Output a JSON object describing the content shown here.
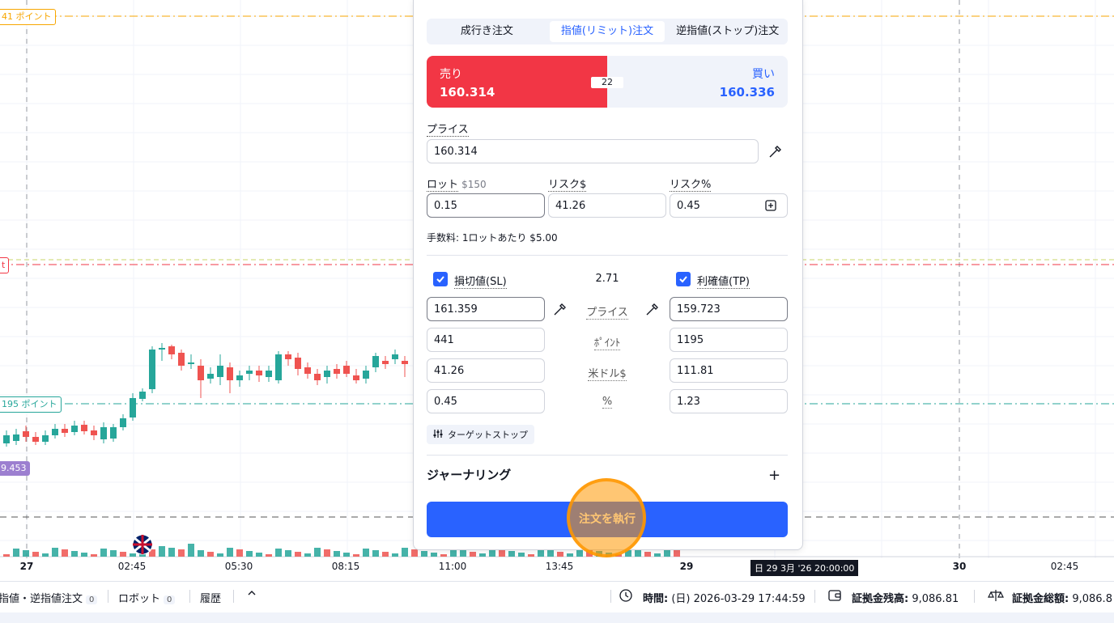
{
  "chart": {
    "labels": {
      "tp_points": "41 ポイント",
      "left_t": "t",
      "sl_points": "195 ポイント",
      "price_tag": "9.453"
    },
    "x_ticks": [
      {
        "label": "27",
        "bold": true
      },
      {
        "label": "02:45",
        "bold": false
      },
      {
        "label": "05:30",
        "bold": false
      },
      {
        "label": "08:15",
        "bold": false
      },
      {
        "label": "11:00",
        "bold": false
      },
      {
        "label": "13:45",
        "bold": false
      },
      {
        "label": "29",
        "bold": true
      },
      {
        "label": "30",
        "bold": true
      },
      {
        "label": "02:45",
        "bold": false
      }
    ],
    "cursor_time": "日 29 3月 '26 20:00:00",
    "colors": {
      "up": "#26a69a",
      "down": "#ef5350",
      "tp_line": "#f7a600",
      "sl_line": "#26a69a",
      "entry_line": "#f23645"
    }
  },
  "panel": {
    "tabs": [
      "成行き注文",
      "指値(リミット)注文",
      "逆指値(ストップ)注文"
    ],
    "active_tab": "指値(リミット)注文",
    "sell_label": "売り",
    "sell_price": "160.314",
    "buy_label": "買い",
    "buy_price": "160.336",
    "spread": "22",
    "price_label": "プライス",
    "price_value": "160.314",
    "lot_label": "ロット",
    "lot_sub": "$150",
    "lot_value": "0.15",
    "risk_usd_label": "リスク$",
    "risk_usd_value": "41.26",
    "risk_pct_label": "リスク%",
    "risk_pct_value": "0.45",
    "fee_text": "手数料: 1ロットあたり $5.00",
    "sl_label": "損切値(SL)",
    "rr_value": "2.71",
    "tp_label": "利確値(TP)",
    "mid_labels": [
      "プライス",
      "ﾎﾟｲﾝﾄ",
      "米ドル$",
      "%"
    ],
    "sl_values": [
      "161.359",
      "441",
      "41.26",
      "0.45"
    ],
    "tp_values": [
      "159.723",
      "1195",
      "111.81",
      "1.23"
    ],
    "trailing_label": "ターゲットストップ",
    "journal_label": "ジャーナリング",
    "execute_label": "注文を執行"
  },
  "bottombar": {
    "orders_label": "指値・逆指値注文",
    "orders_count": "0",
    "robot_label": "ロボット",
    "robot_count": "0",
    "history_label": "履歴",
    "time_label": "時間:",
    "time_value": "(日) 2026-03-29 17:44:59",
    "balance_label": "証拠金残高:",
    "balance_value": "9,086.81",
    "equity_label": "証拠金総額:",
    "equity_value": "9,086.8"
  }
}
